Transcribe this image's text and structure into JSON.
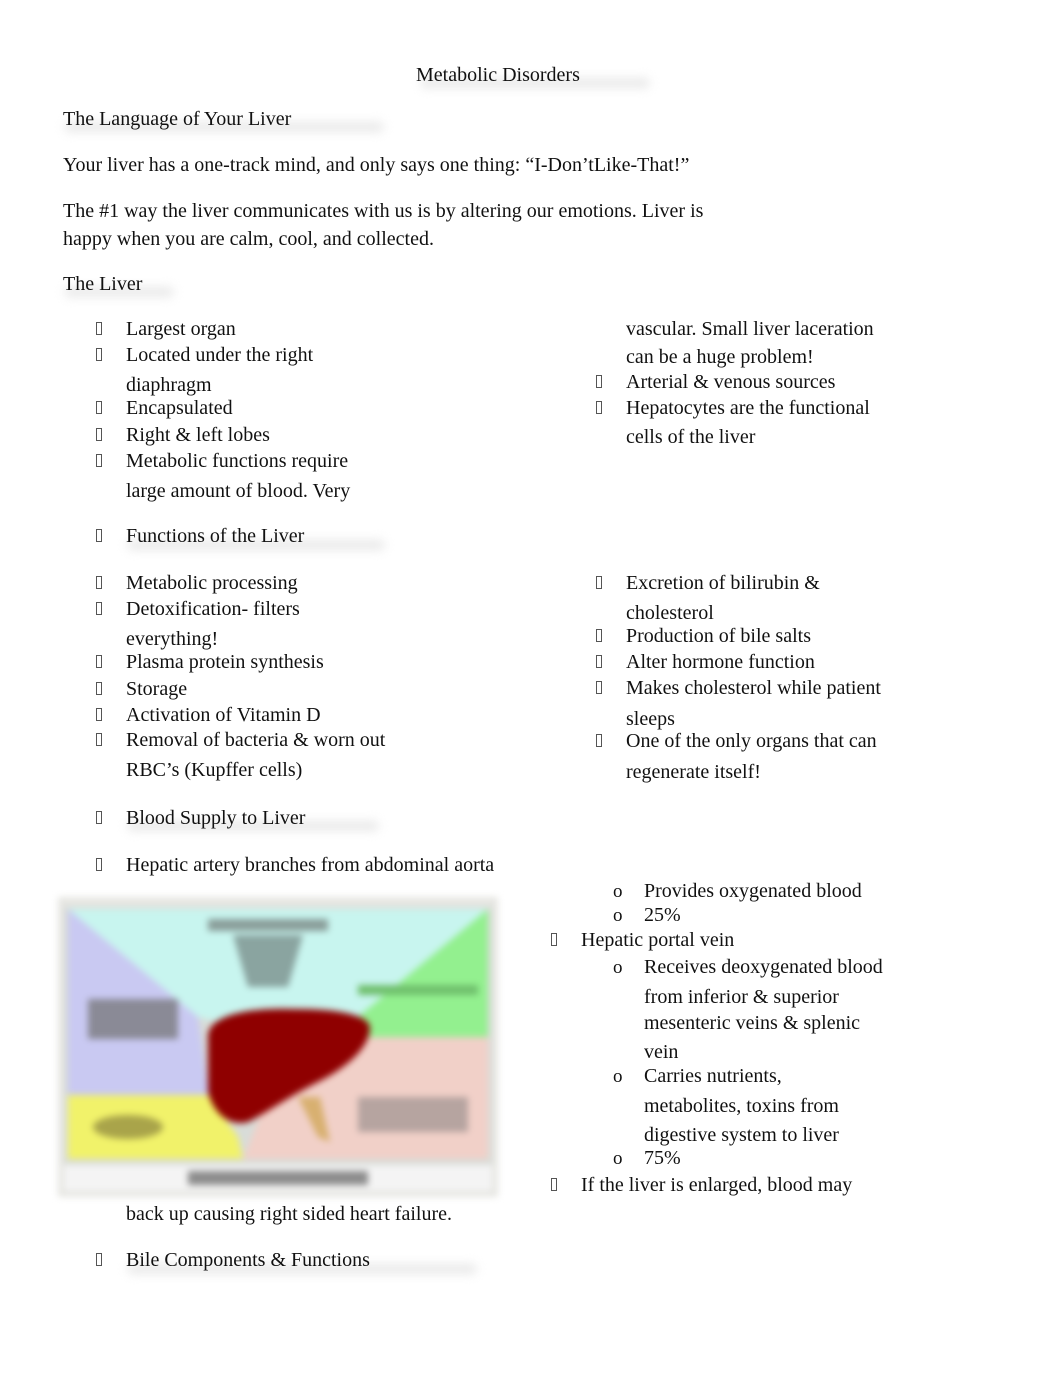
{
  "document": {
    "title": "Metabolic Disorders",
    "section_language": {
      "heading": "The Language of Your Liver",
      "para1": "Your liver has a one-track mind, and only says one thing: “I-Don’tLike-That!”",
      "para2_line1": "The #1 way the liver communicates with us is by altering our emotions. Liver is",
      "para2_line2": "happy when you are calm, cool, and collected."
    },
    "section_liver": {
      "heading": "The Liver",
      "left_items": [
        {
          "lines": [
            "Largest organ"
          ]
        },
        {
          "lines": [
            "Located under the right",
            "diaphragm"
          ]
        },
        {
          "lines": [
            "Encapsulated"
          ]
        },
        {
          "lines": [
            "Right & left lobes"
          ]
        },
        {
          "lines": [
            "Metabolic functions require",
            "large amount of blood. Very"
          ]
        }
      ],
      "right_continuation": [
        "vascular. Small liver laceration",
        "can be a huge problem!"
      ],
      "right_items": [
        {
          "lines": [
            "Arterial & venous sources"
          ]
        },
        {
          "lines": [
            "Hepatocytes are the functional",
            "cells of the liver"
          ]
        }
      ]
    },
    "section_functions": {
      "heading": "Functions of the Liver",
      "left_items": [
        {
          "lines": [
            "Metabolic processing"
          ]
        },
        {
          "lines": [
            "Detoxification- filters",
            "everything!"
          ]
        },
        {
          "lines": [
            "Plasma protein synthesis"
          ]
        },
        {
          "lines": [
            "Storage"
          ]
        },
        {
          "lines": [
            "Activation of Vitamin D"
          ]
        },
        {
          "lines": [
            "Removal of bacteria & worn out",
            "RBC’s (Kupffer cells)"
          ]
        }
      ],
      "right_items": [
        {
          "lines": [
            "Excretion of bilirubin &",
            "cholesterol"
          ]
        },
        {
          "lines": [
            "Production of bile salts"
          ]
        },
        {
          "lines": [
            "Alter hormone function"
          ]
        },
        {
          "lines": [
            "Makes cholesterol while patient",
            "sleeps"
          ]
        },
        {
          "lines": [
            "One of the only organs that can",
            "regenerate itself!"
          ]
        }
      ]
    },
    "section_blood": {
      "heading": "Blood Supply to Liver",
      "hepatic_artery": "Hepatic artery branches from abdominal aorta",
      "artery_sub": [
        "Provides oxygenated blood",
        "25%"
      ],
      "portal_vein": "Hepatic portal vein",
      "portal_sub": [
        {
          "lines": [
            "Receives deoxygenated blood",
            "from inferior & superior",
            "mesenteric veins & splenic",
            "vein"
          ]
        },
        {
          "lines": [
            "Carries nutrients,",
            "metabolites, toxins from",
            "digestive system to liver"
          ]
        },
        {
          "lines": [
            "75%"
          ]
        }
      ],
      "enlarged_line1": "If the liver is enlarged, blood may",
      "enlarged_line2": "back up causing right sided heart failure."
    },
    "section_bile": {
      "heading": "Bile Components & Functions"
    },
    "sub_bullet_glyph": "o",
    "diagram": {
      "description": "Liver functions diagram (blurred)",
      "colors": {
        "top_panel": "#c8f5ef",
        "left_panel": "#c9c9f2",
        "right_panel": "#93f08f",
        "bottom_left_panel": "#f1f26a",
        "bottom_right_panel": "#f1d0c8",
        "liver": "#8f0000"
      }
    }
  }
}
